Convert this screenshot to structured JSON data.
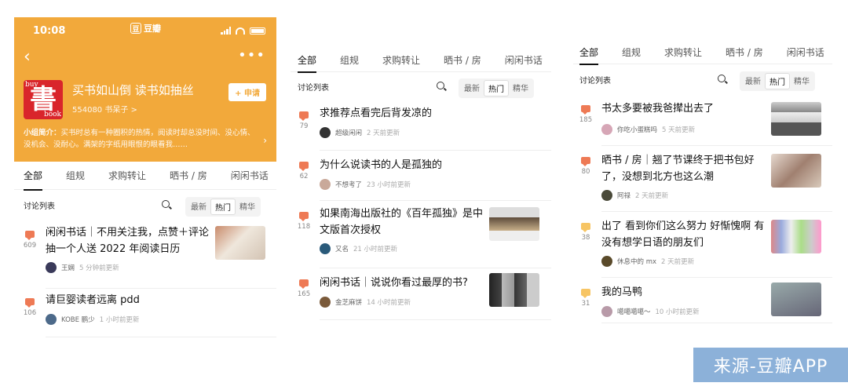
{
  "status": {
    "time": "10:08",
    "app_name": "豆瓣",
    "app_badge": "豆"
  },
  "group": {
    "name": "买书如山倒 读书如抽丝",
    "members": "554080 书呆子 >",
    "join_label": "+ 申请",
    "intro_label": "小组简介：",
    "intro_text": "买书时总有一种圈积的热情，阅读时却总没时间、没心情、没机会、没耐心。满架的字纸用眼恨的眼看我……",
    "avatar_text": "書",
    "avatar_tl": "buy",
    "avatar_br": "book"
  },
  "tabs": [
    "全部",
    "组规",
    "求购转让",
    "晒书 / 房",
    "闲闲书话"
  ],
  "toolbar": {
    "label": "讨论列表",
    "seg": [
      "最新",
      "热门",
      "精华"
    ]
  },
  "panel1_posts": [
    {
      "count": "609",
      "title": "闲闲书话｜不用关注我，点赞＋评论抽一个人送 2022 年阅读日历",
      "user": "王娴",
      "time": "5 分钟前更新"
    },
    {
      "count": "106",
      "title": "请巨婴读者远离 pdd",
      "user": "KOBE 鹏少",
      "time": "1 小时前更新"
    }
  ],
  "panel2_posts": [
    {
      "count": "79",
      "title": "求推荐点看完后背发凉的",
      "user": "超级闲闲",
      "time": "2 天前更新"
    },
    {
      "count": "62",
      "title": "为什么说读书的人是孤独的",
      "user": "不想考了",
      "time": "23 小时前更新"
    },
    {
      "count": "118",
      "title": "如果南海出版社的《百年孤独》是中文版首次授权",
      "user": "又名",
      "time": "21 小时前更新"
    },
    {
      "count": "165",
      "title": "闲闲书话｜说说你看过最厚的书?",
      "user": "金芝麻饼",
      "time": "14 小时前更新"
    }
  ],
  "panel3_posts": [
    {
      "count": "185",
      "title": "书太多要被我爸撵出去了",
      "user": "你吃小蛋糕吗",
      "time": "5 天前更新"
    },
    {
      "count": "80",
      "title": "晒书 / 房｜翘了节课终于把书包好了，没想到北方也这么潮",
      "user": "阿禄",
      "time": "2 天前更新"
    },
    {
      "count": "38",
      "title": "出了 看到你们这么努力 好惭愧啊 有没有想学日语的朋友们",
      "user": "休息中的 mx",
      "time": "2 天前更新"
    },
    {
      "count": "31",
      "title": "我的马鸭",
      "user": "噶噶噶噶～",
      "time": "10 小时前更新"
    }
  ],
  "watermark": "来源-豆瓣APP",
  "colors": {
    "header": "#f2a93b",
    "accent_icon": "#ee7a55",
    "light_icon": "#f7c564",
    "watermark_bg": "#8cb1d9"
  }
}
